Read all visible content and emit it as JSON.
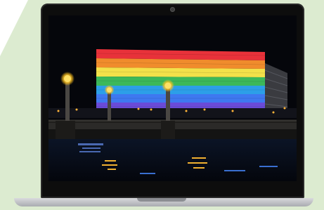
{
  "colors": {
    "background_accent": "#dcebd0",
    "bezel": "#0d0d0d",
    "night_sky": "#05060b",
    "flag_stripes": [
      "#e8323a",
      "#f08c2c",
      "#f3e14a",
      "#3cb85a",
      "#2c9fe8",
      "#6a4bd8"
    ],
    "lamp_glow": "#ffd23a",
    "water": "#0a1020"
  },
  "icons": {
    "camera": "webcam-dot"
  }
}
